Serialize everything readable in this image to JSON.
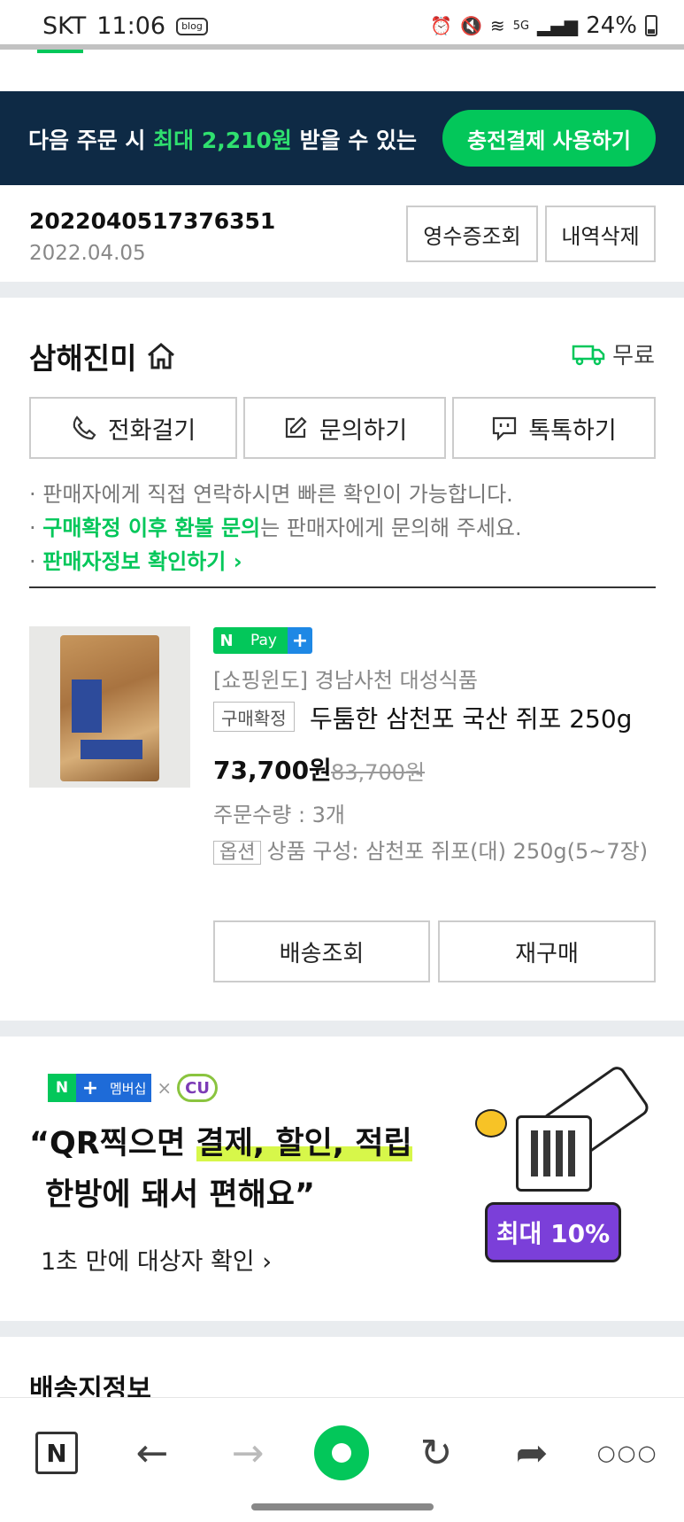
{
  "status_bar": {
    "carrier": "SKT",
    "time": "11:06",
    "blog_badge": "blog",
    "battery": "24%",
    "network": "5G"
  },
  "promo": {
    "text_pre": "다음 주문 시 ",
    "text_highlight": "최대 2,210원",
    "text_post": " 받을 수 있는",
    "button": "충전결제 사용하기"
  },
  "order": {
    "number": "2022040517376351",
    "date": "2022.04.05",
    "receipt_button": "영수증조회",
    "delete_button": "내역삭제"
  },
  "seller": {
    "name": "삼해진미",
    "shipping_fee": "무료",
    "buttons": {
      "call": "전화걸기",
      "inquiry": "문의하기",
      "talk": "톡톡하기"
    },
    "notices": {
      "n1": "판매자에게 직접 연락하시면 빠른 확인이 가능합니다.",
      "n2_highlight": "구매확정 이후 환불 문의",
      "n2_rest": "는 판매자에게 문의해 주세요.",
      "n3": "판매자정보 확인하기"
    }
  },
  "product": {
    "npay": {
      "n": "N",
      "pay": "Pay",
      "plus": "+"
    },
    "shop": "[쇼핑윈도] 경남사천 대성식품",
    "status": "구매확정",
    "name": "두툼한 삼천포 국산 쥐포 250g",
    "price": "73,700원",
    "original_price": "83,700원",
    "quantity": "주문수량 : 3개",
    "option_tag": "옵션",
    "option_text": "상품 구성: 삼천포 쥐포(대) 250g(5~7장)",
    "track_button": "배송조회",
    "rebuy_button": "재구매"
  },
  "ad": {
    "badge_n": "N",
    "badge_plus": "+",
    "badge_membership": "멤버십",
    "badge_x": "×",
    "badge_cu": "CU",
    "head_open": "“QR찍으면 ",
    "head_mark": "결제, 할인, 적립",
    "head_line2": "한방에 돼서 편해요”",
    "sub": "1초 만에 대상자 확인",
    "discount": "최대 10%"
  },
  "shipping_title": "배송지정보",
  "bottom_nav": {
    "home": "N"
  },
  "colors": {
    "accent": "#03c75a",
    "banner_bg": "#0e2a45",
    "purple": "#7b3fd9"
  }
}
